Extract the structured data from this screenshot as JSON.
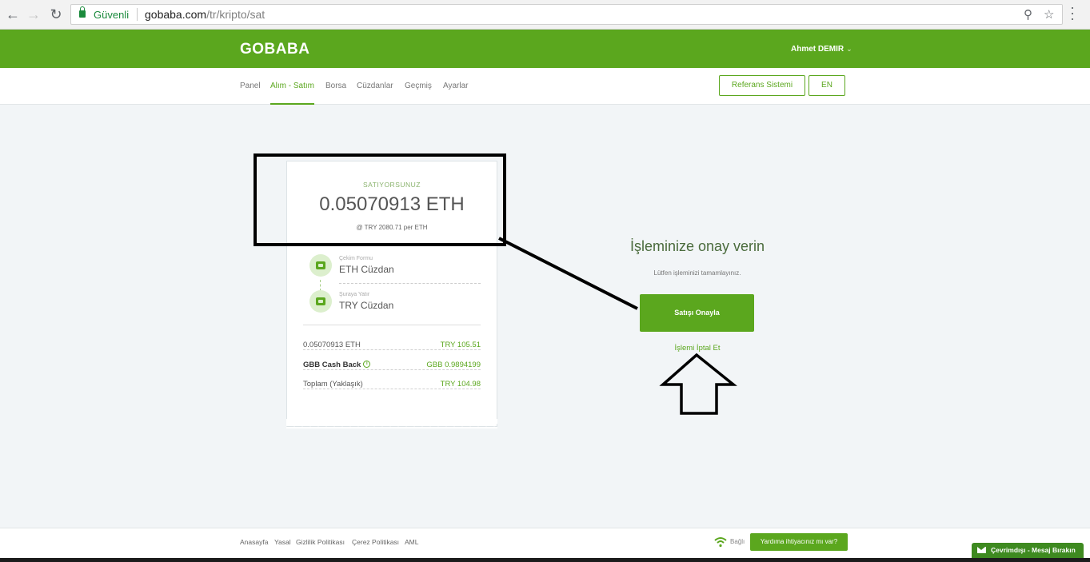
{
  "browser": {
    "secure_label": "Güvenli",
    "url_host": "gobaba.com",
    "url_path": "/tr/kripto/sat"
  },
  "header": {
    "logo": "GOBABA",
    "user_name": "Ahmet DEMIR"
  },
  "nav": {
    "items": [
      "Panel",
      "Alım - Satım",
      "Borsa",
      "Cüzdanlar",
      "Geçmiş",
      "Ayarlar"
    ],
    "active_index": 1,
    "referral_button": "Referans Sistemi",
    "lang_button": "EN"
  },
  "receipt": {
    "sell_label": "SATIYORSUNUZ",
    "amount": "0.05070913 ETH",
    "rate": "@ TRY 2080.71 per ETH",
    "from": {
      "label": "Çekim Formu",
      "value": "ETH Cüzdan"
    },
    "to": {
      "label": "Şuraya Yatır",
      "value": "TRY Cüzdan"
    },
    "summary": [
      {
        "label": "0.05070913 ETH",
        "value": "TRY 105.51"
      },
      {
        "label": "GBB Cash Back",
        "value": "GBB 0.9894199"
      },
      {
        "label": "Toplam (Yaklaşık)",
        "value": "TRY 104.98"
      }
    ]
  },
  "confirm": {
    "title": "İşleminize onay verin",
    "subtitle": "Lütfen işleminizi tamamlayınız.",
    "confirm_button": "Satışı Onayla",
    "cancel_link": "İşlemi İptal Et"
  },
  "footer": {
    "links": [
      "Anasayfa",
      "Yasal",
      "Gizlilik Politikası",
      "Çerez Politikası",
      "AML"
    ],
    "status": "Bağlı",
    "help_button": "Yardıma ihtiyacınız mı var?",
    "chat_tab": "Çevrimdışı - Mesaj Bırakın"
  },
  "colors": {
    "brand_green": "#5ba71e",
    "annotation": "#000000"
  }
}
